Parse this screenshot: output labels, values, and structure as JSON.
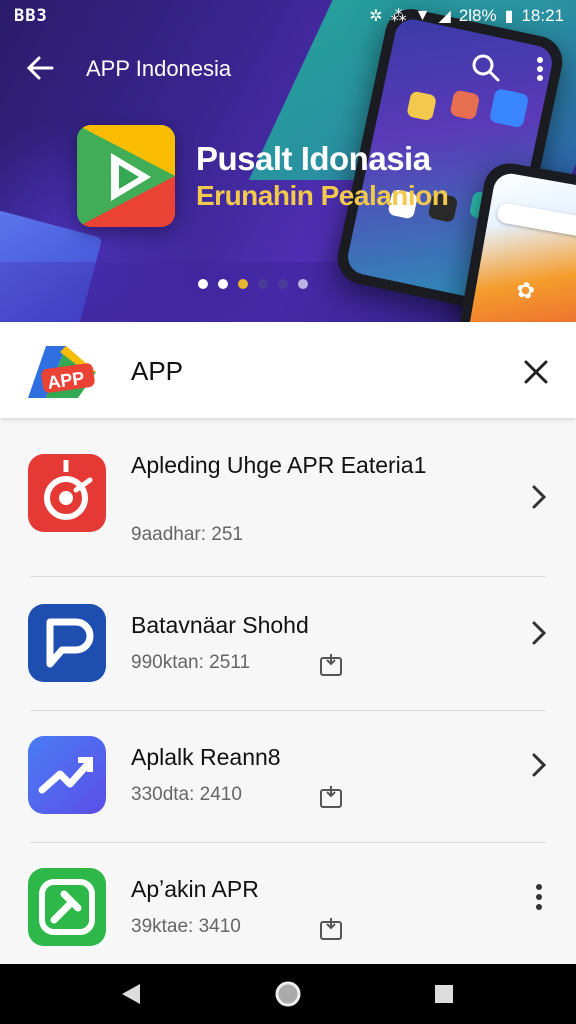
{
  "status_bar": {
    "left_text": "BB3",
    "battery": "2l8%",
    "time": "18:21"
  },
  "app_bar": {
    "title": "APP Indonesia",
    "icons": [
      "back-arrow-icon",
      "search-icon",
      "more-vert-icon"
    ]
  },
  "banner": {
    "title": "Pusalt Idonasia",
    "subtitle": "Erunahin Pealanion",
    "dots_count": 6,
    "active_dot": 2,
    "colors": {
      "title": "#ffffff",
      "subtitle": "#f2c94c",
      "active_dot": "#e8b62e"
    }
  },
  "header": {
    "title": "APP",
    "logo_text": "APP"
  },
  "list": [
    {
      "name": "Apleding Uhge APR Eateria1",
      "meta": "9aadhar: 251",
      "action": "chevron-right-icon",
      "icon": "target-icon",
      "color": "#e53935",
      "show_pkg": false
    },
    {
      "name": "Batavnäar Shohd",
      "meta": "990ktan: 2511",
      "action": "chevron-right-icon",
      "icon": "p-icon",
      "color": "#1e4fb0",
      "show_pkg": true
    },
    {
      "name": "Aplalk Reann8",
      "meta": "330dta: 2410",
      "action": "chevron-right-icon",
      "icon": "chart-icon",
      "color": "#3d6df0",
      "show_pkg": true
    },
    {
      "name": "Apʼakin APR",
      "meta": "39ktae: 3410",
      "action": "more-vert-icon",
      "icon": "gavel-icon",
      "color": "#2eb84a",
      "show_pkg": true
    }
  ],
  "nav_bar": {
    "buttons": [
      "back-triangle-icon",
      "home-circle-icon",
      "recents-square-icon"
    ]
  }
}
